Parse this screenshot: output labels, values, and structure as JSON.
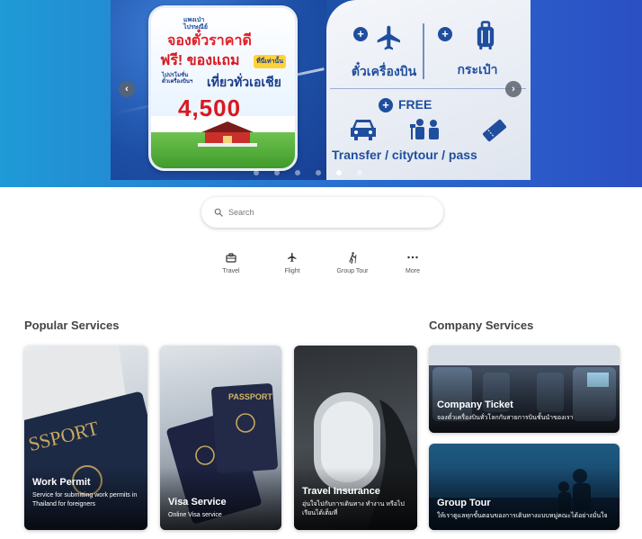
{
  "banner": {
    "small_text_1": "แพงเป่า",
    "small_text_2": "ไปรษณีย์",
    "headline_1": "จองตั๋วราคาดี",
    "headline_2": "ฟรี! ของแถม",
    "tag": "ที่นี่เท่านั้น",
    "sub_small_1": "ไปปรโมชั่น",
    "sub_small_2": "ตั๋วเครื่องบินฯ",
    "sub_headline": "เที่ยวทั่วเอเชีย",
    "price": "4,500",
    "flight_label": "ตั๋วเครื่องบิน",
    "bag_label": "กระเป๋า",
    "plus": "+",
    "free_label": "FREE",
    "extras_label": "Transfer / citytour / pass",
    "prev_arrow": "‹",
    "next_arrow": "›",
    "slide_count": 6,
    "active_slide": 5
  },
  "search": {
    "placeholder": "Search"
  },
  "categories": [
    {
      "label": "Travel",
      "icon": "briefcase-icon"
    },
    {
      "label": "Flight",
      "icon": "airplane-icon"
    },
    {
      "label": "Group Tour",
      "icon": "hiker-icon"
    },
    {
      "label": "More",
      "icon": "more-dots-icon"
    }
  ],
  "sections": {
    "popular_title": "Popular Services",
    "company_title": "Company Services"
  },
  "popular": [
    {
      "title": "Work Permit",
      "desc": "Service for submitting work permits in Thailand for foreigners"
    },
    {
      "title": "Visa Service",
      "desc": "Online Visa service"
    },
    {
      "title": "Travel Insurance",
      "desc": "อุ่นใจไปกับการเดินทาง ทำงาน หรือไปเรียนได้เต็มที่"
    }
  ],
  "company": [
    {
      "title": "Company Ticket",
      "desc": "จองตั๋วเครื่องบินทั่วโลกกับสายการบินชั้นนำของเรา"
    },
    {
      "title": "Group Tour",
      "desc": "ให้เราดูแลทุกขั้นตอนของการเดินทางแบบหมู่คณะได้อย่างมั่นใจ"
    }
  ]
}
